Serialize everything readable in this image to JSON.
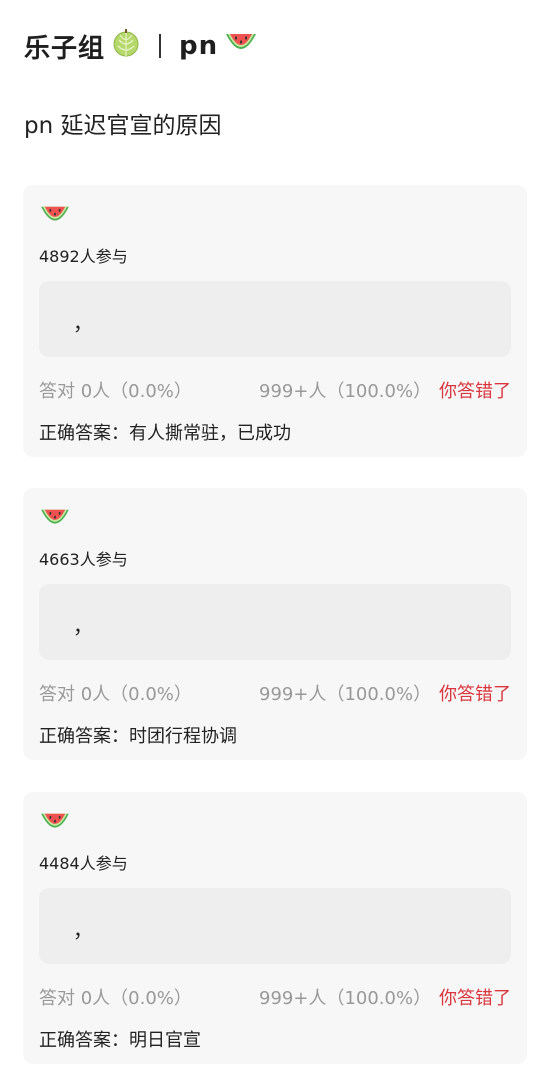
{
  "header": {
    "group_name": "乐子组",
    "name": "pn",
    "group_icon": "melon-icon",
    "name_icon": "watermelon-icon"
  },
  "question": {
    "title": "pn 延迟官宣的原因"
  },
  "colors": {
    "wrong_text": "#d9363e",
    "muted_text": "#999999",
    "card_bg": "#f7f7f7",
    "answer_bg": "#eeeeee"
  },
  "cards": [
    {
      "icon": "watermelon-icon",
      "participants": "4892人参与",
      "answer_text": "，",
      "correct_stat": "答对  0人（0.0%）",
      "wrong_stat": "999+人（100.0%）",
      "verdict": "你答错了",
      "correct_answer": "正确答案：有人撕常驻，已成功"
    },
    {
      "icon": "watermelon-icon",
      "participants": "4663人参与",
      "answer_text": "，",
      "correct_stat": "答对  0人（0.0%）",
      "wrong_stat": "999+人（100.0%）",
      "verdict": "你答错了",
      "correct_answer": "正确答案：时团行程协调"
    },
    {
      "icon": "watermelon-icon",
      "participants": "4484人参与",
      "answer_text": "，",
      "correct_stat": "答对  0人（0.0%）",
      "wrong_stat": "999+人（100.0%）",
      "verdict": "你答错了",
      "correct_answer": "正确答案：明日官宣"
    }
  ]
}
